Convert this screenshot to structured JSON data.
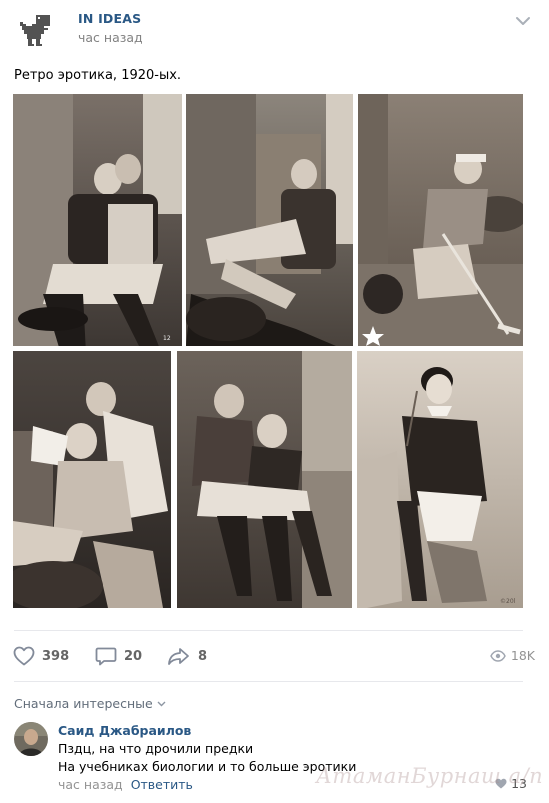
{
  "post": {
    "group_name": "IN IDEAS",
    "time": "час назад",
    "text": "Ретро эротика, 1920-ых."
  },
  "photos": [
    {
      "name": "retro-photo-1",
      "caption": "12"
    },
    {
      "name": "retro-photo-2",
      "caption": ""
    },
    {
      "name": "retro-photo-3",
      "caption": ""
    },
    {
      "name": "retro-photo-4",
      "caption": ""
    },
    {
      "name": "retro-photo-5",
      "caption": ""
    },
    {
      "name": "retro-photo-6",
      "caption": "©20l"
    }
  ],
  "actions": {
    "likes": "398",
    "comments": "20",
    "shares": "8",
    "views": "18K"
  },
  "comments_section": {
    "sort_label": "Сначала интересные"
  },
  "comment": {
    "author": "Саид Джабраилов",
    "line1": "Пздц, на что дрочили предки",
    "line2": "На учебниках биологии и то больше эротики",
    "time": "час назад",
    "reply_label": "Ответить",
    "likes": "13"
  },
  "watermark": "АтаманБурнаш а/п",
  "icons": {
    "group_avatar": "dino-icon",
    "more": "chevron-down-icon",
    "like": "heart-icon",
    "comment": "comment-icon",
    "share": "share-icon",
    "views": "eye-icon"
  },
  "colors": {
    "link": "#2a5885",
    "muted": "#939393",
    "divider": "#e7e8ec"
  }
}
